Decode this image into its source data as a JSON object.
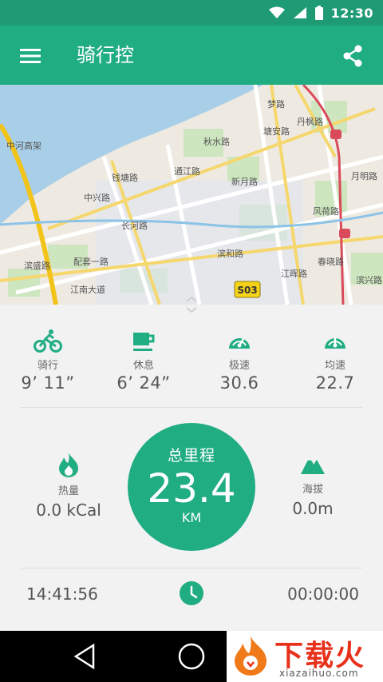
{
  "status_bar": {
    "time": "12:30",
    "icons": [
      "wifi-icon",
      "signal-icon",
      "battery-icon"
    ]
  },
  "app_bar": {
    "title": "骑行控",
    "menu_icon": "menu-icon",
    "share_icon": "share-icon"
  },
  "map": {
    "labels": [
      "秋水路",
      "梦路",
      "塘安路",
      "丹枫路",
      "通江路",
      "新月路",
      "月明路",
      "长河路",
      "风荷路",
      "钱塘路",
      "滨盛路",
      "配套一路",
      "滨和路",
      "中河高架",
      "江南大道",
      "江晖路",
      "春晓路",
      "滨兴路",
      "中兴路",
      "S03"
    ]
  },
  "stats": [
    {
      "icon": "bicycle-icon",
      "label": "骑行",
      "value": "9’ 11”"
    },
    {
      "icon": "coffee-cup-icon",
      "label": "休息",
      "value": "6’ 24”"
    },
    {
      "icon": "speedometer-icon",
      "label": "极速",
      "value": "30.6"
    },
    {
      "icon": "speedometer-icon",
      "label": "均速",
      "value": "22.7"
    }
  ],
  "calories": {
    "icon": "flame-icon",
    "label": "热量",
    "value": "0.0 kCal"
  },
  "altitude": {
    "icon": "mountain-icon",
    "label": "海拔",
    "value": "0.0m"
  },
  "distance": {
    "title": "总里程",
    "value": "23.4",
    "unit": "KM"
  },
  "times": {
    "start": "14:41:56",
    "elapsed": "00:00:00",
    "icon": "clock-icon"
  },
  "watermark": {
    "text": "下载火",
    "sub": "xiazaihuo.com"
  },
  "colors": {
    "primary": "#21ad82",
    "dark": "#1f9b74"
  }
}
